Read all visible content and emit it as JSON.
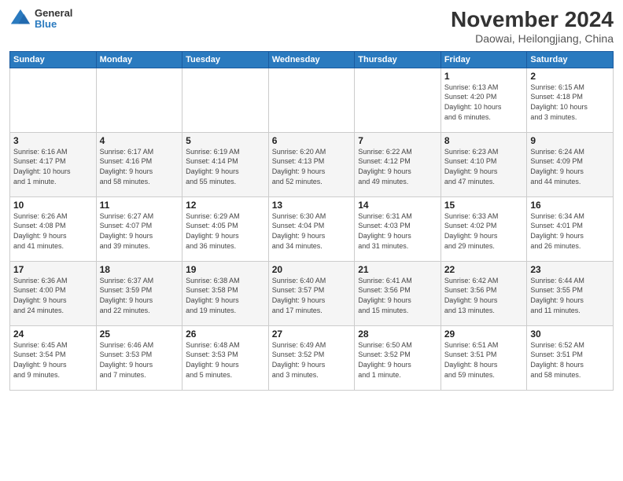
{
  "logo": {
    "general": "General",
    "blue": "Blue"
  },
  "header": {
    "month_title": "November 2024",
    "location": "Daowai, Heilongjiang, China"
  },
  "weekdays": [
    "Sunday",
    "Monday",
    "Tuesday",
    "Wednesday",
    "Thursday",
    "Friday",
    "Saturday"
  ],
  "weeks": [
    [
      {
        "day": "",
        "info": ""
      },
      {
        "day": "",
        "info": ""
      },
      {
        "day": "",
        "info": ""
      },
      {
        "day": "",
        "info": ""
      },
      {
        "day": "",
        "info": ""
      },
      {
        "day": "1",
        "info": "Sunrise: 6:13 AM\nSunset: 4:20 PM\nDaylight: 10 hours\nand 6 minutes."
      },
      {
        "day": "2",
        "info": "Sunrise: 6:15 AM\nSunset: 4:18 PM\nDaylight: 10 hours\nand 3 minutes."
      }
    ],
    [
      {
        "day": "3",
        "info": "Sunrise: 6:16 AM\nSunset: 4:17 PM\nDaylight: 10 hours\nand 1 minute."
      },
      {
        "day": "4",
        "info": "Sunrise: 6:17 AM\nSunset: 4:16 PM\nDaylight: 9 hours\nand 58 minutes."
      },
      {
        "day": "5",
        "info": "Sunrise: 6:19 AM\nSunset: 4:14 PM\nDaylight: 9 hours\nand 55 minutes."
      },
      {
        "day": "6",
        "info": "Sunrise: 6:20 AM\nSunset: 4:13 PM\nDaylight: 9 hours\nand 52 minutes."
      },
      {
        "day": "7",
        "info": "Sunrise: 6:22 AM\nSunset: 4:12 PM\nDaylight: 9 hours\nand 49 minutes."
      },
      {
        "day": "8",
        "info": "Sunrise: 6:23 AM\nSunset: 4:10 PM\nDaylight: 9 hours\nand 47 minutes."
      },
      {
        "day": "9",
        "info": "Sunrise: 6:24 AM\nSunset: 4:09 PM\nDaylight: 9 hours\nand 44 minutes."
      }
    ],
    [
      {
        "day": "10",
        "info": "Sunrise: 6:26 AM\nSunset: 4:08 PM\nDaylight: 9 hours\nand 41 minutes."
      },
      {
        "day": "11",
        "info": "Sunrise: 6:27 AM\nSunset: 4:07 PM\nDaylight: 9 hours\nand 39 minutes."
      },
      {
        "day": "12",
        "info": "Sunrise: 6:29 AM\nSunset: 4:05 PM\nDaylight: 9 hours\nand 36 minutes."
      },
      {
        "day": "13",
        "info": "Sunrise: 6:30 AM\nSunset: 4:04 PM\nDaylight: 9 hours\nand 34 minutes."
      },
      {
        "day": "14",
        "info": "Sunrise: 6:31 AM\nSunset: 4:03 PM\nDaylight: 9 hours\nand 31 minutes."
      },
      {
        "day": "15",
        "info": "Sunrise: 6:33 AM\nSunset: 4:02 PM\nDaylight: 9 hours\nand 29 minutes."
      },
      {
        "day": "16",
        "info": "Sunrise: 6:34 AM\nSunset: 4:01 PM\nDaylight: 9 hours\nand 26 minutes."
      }
    ],
    [
      {
        "day": "17",
        "info": "Sunrise: 6:36 AM\nSunset: 4:00 PM\nDaylight: 9 hours\nand 24 minutes."
      },
      {
        "day": "18",
        "info": "Sunrise: 6:37 AM\nSunset: 3:59 PM\nDaylight: 9 hours\nand 22 minutes."
      },
      {
        "day": "19",
        "info": "Sunrise: 6:38 AM\nSunset: 3:58 PM\nDaylight: 9 hours\nand 19 minutes."
      },
      {
        "day": "20",
        "info": "Sunrise: 6:40 AM\nSunset: 3:57 PM\nDaylight: 9 hours\nand 17 minutes."
      },
      {
        "day": "21",
        "info": "Sunrise: 6:41 AM\nSunset: 3:56 PM\nDaylight: 9 hours\nand 15 minutes."
      },
      {
        "day": "22",
        "info": "Sunrise: 6:42 AM\nSunset: 3:56 PM\nDaylight: 9 hours\nand 13 minutes."
      },
      {
        "day": "23",
        "info": "Sunrise: 6:44 AM\nSunset: 3:55 PM\nDaylight: 9 hours\nand 11 minutes."
      }
    ],
    [
      {
        "day": "24",
        "info": "Sunrise: 6:45 AM\nSunset: 3:54 PM\nDaylight: 9 hours\nand 9 minutes."
      },
      {
        "day": "25",
        "info": "Sunrise: 6:46 AM\nSunset: 3:53 PM\nDaylight: 9 hours\nand 7 minutes."
      },
      {
        "day": "26",
        "info": "Sunrise: 6:48 AM\nSunset: 3:53 PM\nDaylight: 9 hours\nand 5 minutes."
      },
      {
        "day": "27",
        "info": "Sunrise: 6:49 AM\nSunset: 3:52 PM\nDaylight: 9 hours\nand 3 minutes."
      },
      {
        "day": "28",
        "info": "Sunrise: 6:50 AM\nSunset: 3:52 PM\nDaylight: 9 hours\nand 1 minute."
      },
      {
        "day": "29",
        "info": "Sunrise: 6:51 AM\nSunset: 3:51 PM\nDaylight: 8 hours\nand 59 minutes."
      },
      {
        "day": "30",
        "info": "Sunrise: 6:52 AM\nSunset: 3:51 PM\nDaylight: 8 hours\nand 58 minutes."
      }
    ]
  ]
}
